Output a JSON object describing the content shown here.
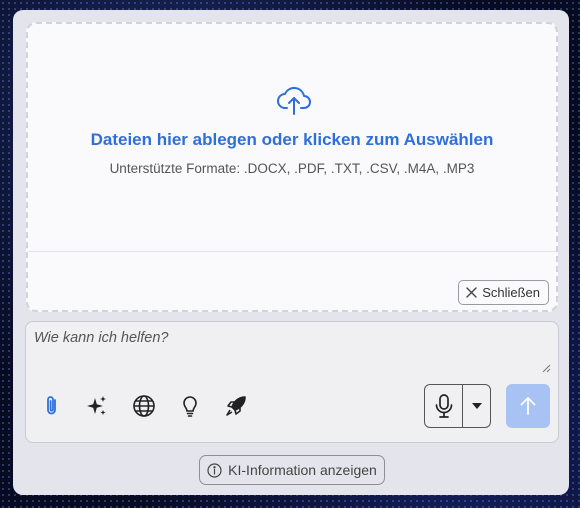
{
  "dropzone": {
    "title": "Dateien hier ablegen oder klicken zum Auswählen",
    "subtitle": "Unterstützte Formate: .DOCX, .PDF, .TXT, .CSV, .M4A, .MP3",
    "close_label": "Schließen",
    "icon": "cloud-upload-icon"
  },
  "composer": {
    "placeholder": "Wie kann ich helfen?",
    "value": "",
    "tools": [
      "paperclip-icon",
      "sparkles-icon",
      "globe-icon",
      "lightbulb-icon",
      "rocket-icon"
    ],
    "mic_icon": "microphone-icon",
    "dropdown_icon": "caret-down-icon",
    "send_icon": "arrow-up-icon"
  },
  "footer": {
    "info_label": "KI-Information anzeigen",
    "info_icon": "info-circle-icon"
  },
  "colors": {
    "accent": "#2f6fdc",
    "send_disabled": "#a7c2f3",
    "panel": "#e4e5ec"
  }
}
